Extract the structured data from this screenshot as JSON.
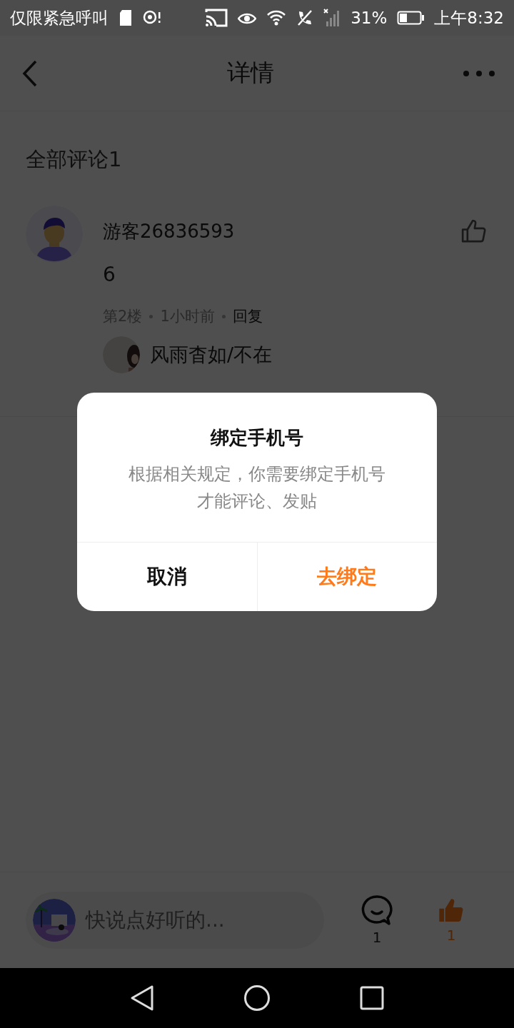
{
  "status_bar": {
    "carrier": "仅限紧急呼叫",
    "battery": "31%",
    "time": "上午8:32"
  },
  "header": {
    "title": "详情"
  },
  "comments_title": "全部评论1",
  "comment": {
    "user": "游客26836593",
    "text": "6",
    "floor": "第2楼",
    "time": "1小时前",
    "reply": "回复",
    "liked": false,
    "replies": [
      {
        "user": "风雨杳如/不在"
      }
    ]
  },
  "bottom_bar": {
    "placeholder": "快说点好听的...",
    "comment_count": "1",
    "like_count": "1",
    "liked": true
  },
  "dialog": {
    "title": "绑定手机号",
    "message": "根据相关规定，你需要绑定手机号才能评论、发贴",
    "buttons": [
      {
        "label": "取消",
        "kind": "cancel"
      },
      {
        "label": "去绑定",
        "kind": "confirm"
      }
    ]
  }
}
